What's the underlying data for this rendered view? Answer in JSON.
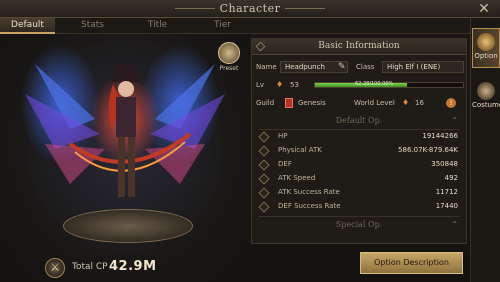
{
  "window": {
    "title": "Character"
  },
  "tabs": [
    {
      "label": "Default",
      "active": true
    },
    {
      "label": "Stats"
    },
    {
      "label": "Title"
    },
    {
      "label": "Tier"
    }
  ],
  "preset": {
    "label": "Preset"
  },
  "combat_power": {
    "label": "Total CP",
    "value": "42.9M"
  },
  "basic_info": {
    "header": "Basic Information",
    "name_label": "Name",
    "name_value": "Headpunch",
    "class_label": "Class",
    "class_value": "High Elf I (ENE)",
    "lv_label": "Lv",
    "lv_value": "53",
    "lv_percent_text": "62.28/100.00%",
    "lv_progress": 0.6228,
    "guild_label": "Guild",
    "guild_value": "Genesis",
    "world_level_label": "World Level",
    "world_level_value": "16"
  },
  "default_op": {
    "header": "Default Op.",
    "stats": [
      {
        "name": "HP",
        "value": "19144266"
      },
      {
        "name": "Physical ATK",
        "value": "586.07K-879.64K"
      },
      {
        "name": "DEF",
        "value": "350848"
      },
      {
        "name": "ATK Speed",
        "value": "492"
      },
      {
        "name": "ATK Success Rate",
        "value": "11712"
      },
      {
        "name": "DEF Success Rate",
        "value": "17440"
      }
    ]
  },
  "special_op": {
    "header": "Special Op."
  },
  "buttons": {
    "option_description": "Option Description"
  },
  "side_menu": [
    {
      "label": "Option",
      "active": true
    },
    {
      "label": "Costume"
    }
  ],
  "colors": {
    "accent": "#c9a362",
    "xp_green": "#5fb832",
    "panel_bg": "#1f1b17"
  }
}
